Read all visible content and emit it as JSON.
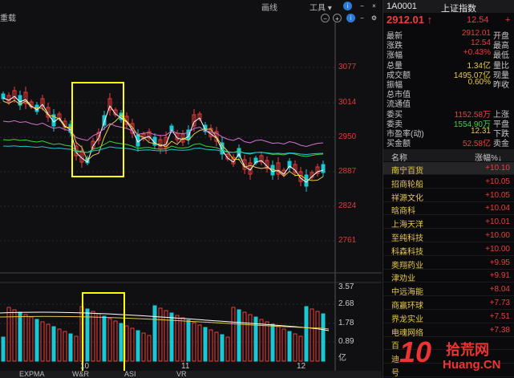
{
  "toolbar": {
    "draw_label": "画线",
    "tools_label": "工具",
    "reload_label": "重载"
  },
  "price_axis": [
    "3077",
    "3014",
    "2950",
    "2887",
    "2824",
    "2761"
  ],
  "volume_axis": [
    "3.57",
    "2.68",
    "1.78",
    "0.89",
    "亿"
  ],
  "date_labels": [
    "10",
    "11",
    "12"
  ],
  "bottom_tabs": [
    "EXPMA",
    "W&R",
    "ASI",
    "VR"
  ],
  "quote": {
    "code": "1A0001",
    "name": "上证指数",
    "price": "2912.01",
    "change": "12.54",
    "change2": "+",
    "rows": [
      {
        "label": "最新",
        "value": "2912.01",
        "label2": "开盘",
        "color": "#f03c3c"
      },
      {
        "label": "涨跌",
        "value": "12.54",
        "label2": "最高",
        "color": "#f03c3c"
      },
      {
        "label": "涨幅",
        "value": "+0.43%",
        "label2": "最低",
        "color": "#f03c3c"
      },
      {
        "label": "总量",
        "value": "1.34亿",
        "label2": "量比",
        "color": "#e6c84a"
      },
      {
        "label": "成交额",
        "value": "1495.07亿",
        "label2": "现量",
        "color": "#e6c84a"
      },
      {
        "label": "振幅",
        "value": "0.60%",
        "label2": "昨收",
        "color": "#e6c84a"
      },
      {
        "label": "总市值",
        "value": "",
        "label2": "",
        "color": "#e6c84a"
      },
      {
        "label": "流通值",
        "value": "",
        "label2": "",
        "color": "#e6c84a"
      },
      {
        "label": "委买",
        "value": "1152.58万",
        "label2": "上涨",
        "color": "#f03c3c"
      },
      {
        "label": "委卖",
        "value": "1554.90万",
        "label2": "平盘",
        "color": "#3cd23c"
      },
      {
        "label": "市盈率(动)",
        "value": "12.31",
        "label2": "下跌",
        "color": "#e6c84a"
      },
      {
        "label": "买金额",
        "value": "52.58亿",
        "label2": "卖金",
        "color": "#f03c3c"
      }
    ]
  },
  "list": {
    "col_name": "名称",
    "col_pct": "涨幅%↓",
    "rows": [
      {
        "name": "南宁百货",
        "pct": "+10.10"
      },
      {
        "name": "招商轮船",
        "pct": "+10.05"
      },
      {
        "name": "祥源文化",
        "pct": "+10.05"
      },
      {
        "name": "晗商科",
        "pct": "+10.04"
      },
      {
        "name": "上海天洋",
        "pct": "+10.01"
      },
      {
        "name": "至纯科技",
        "pct": "+10.00"
      },
      {
        "name": "科森科技",
        "pct": "+10.00"
      },
      {
        "name": "奥翔药业",
        "pct": "+9.95"
      },
      {
        "name": "津劝业",
        "pct": "+9.91"
      },
      {
        "name": "中远海能",
        "pct": "+8.04"
      },
      {
        "name": "商赢环球",
        "pct": "+7.73"
      },
      {
        "name": "界龙实业",
        "pct": "+7.51"
      },
      {
        "name": "电魂网络",
        "pct": "+7.38"
      },
      {
        "name": "百",
        "pct": ""
      },
      {
        "name": "迪",
        "pct": ""
      },
      {
        "name": "号",
        "pct": ""
      }
    ]
  },
  "watermark": {
    "num": "10",
    "text": "拾荒网",
    "url": "Huang.CN"
  },
  "colors": {
    "up": "#f03c3c",
    "down": "#19c8d2",
    "highlight": "#ffff00"
  }
}
